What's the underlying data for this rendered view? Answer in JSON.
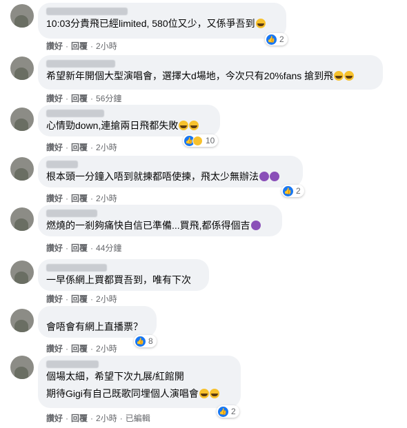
{
  "comments": [
    {
      "text": "10:03分貴飛已經limited, 580位又少，又係爭吾到",
      "emoji": [
        "cry"
      ],
      "reaction_count": "2",
      "time": "2小時"
    },
    {
      "text": "希望新年開個大型演唱會，選擇大d場地，今次只有20%fans 搶到飛",
      "emoji": [
        "cry",
        "cry"
      ],
      "reaction_count": "",
      "time": "56分鐘"
    },
    {
      "text": "心情勁down,連搶兩日飛都失敗",
      "emoji": [
        "cry",
        "cry"
      ],
      "reaction_count": "10",
      "time": "2小時"
    },
    {
      "text": "根本頭一分鐘入唔到就揀都唔使揀，飛太少無辦法",
      "emoji": [
        "purple",
        "purple"
      ],
      "reaction_count": "2",
      "time": "2小時"
    },
    {
      "text": "燃燒的一剎夠痛快自信已準備...買飛,都係得個吉",
      "emoji": [
        "purple"
      ],
      "reaction_count": "",
      "time": "44分鐘"
    },
    {
      "text": "一早係網上買都買吾到，唯有下次",
      "emoji": [],
      "reaction_count": "",
      "time": "2小時"
    },
    {
      "text": "會唔會有網上直播票？",
      "emoji": [],
      "reaction_count": "8",
      "time": "2小時"
    },
    {
      "text": "個場太細，希望下次九展/紅館開",
      "text2": "期待Gigi有自己既歌同埋個人演唱會",
      "emoji": [
        "cry",
        "cry"
      ],
      "reaction_count": "2",
      "time": "2小時",
      "edited": "已編輯"
    }
  ],
  "labels": {
    "like": "讚好",
    "reply": "回覆",
    "dot": "·"
  },
  "colors": {
    "bubble": "#f0f2f5",
    "meta": "#65676b",
    "like": "#1877f2"
  }
}
